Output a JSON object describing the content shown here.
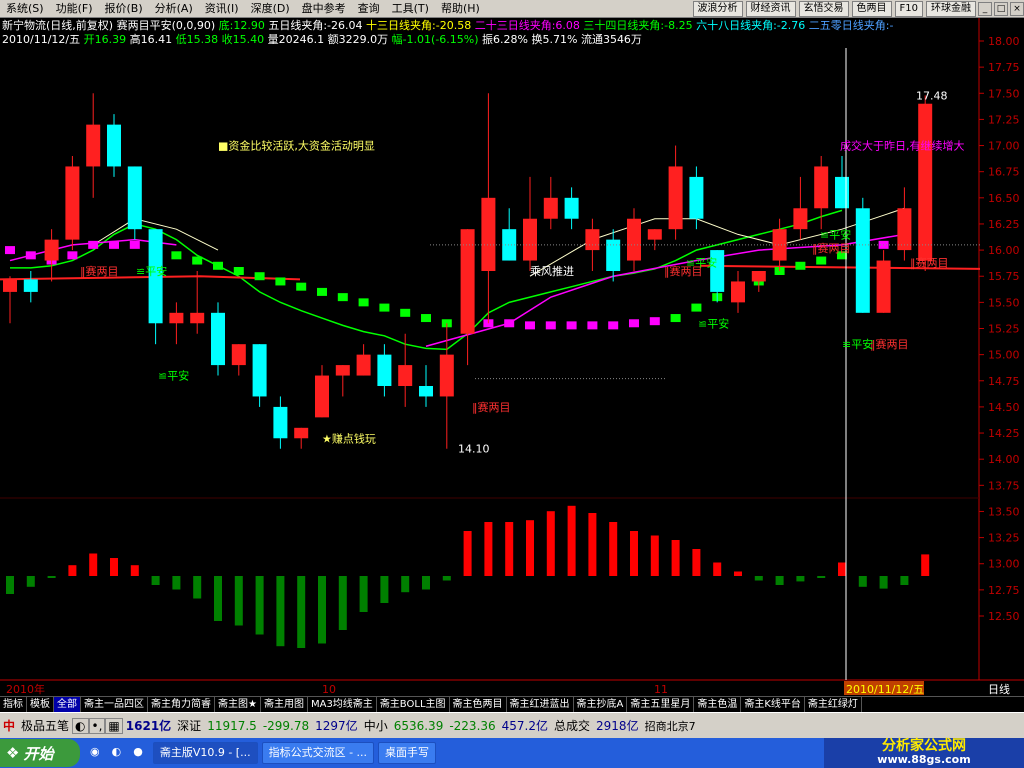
{
  "menu": {
    "items": [
      "系统(S)",
      "功能(F)",
      "报价(B)",
      "分析(A)",
      "资讯(I)",
      "深度(D)",
      "盘中参考",
      "查询",
      "工具(T)",
      "帮助(H)"
    ],
    "right_buttons": [
      "波浪分析",
      "财经资讯",
      "玄悟交易",
      "色两目",
      "F10",
      "环球金融"
    ]
  },
  "header": {
    "line1": "新宁物流(日线,前复权) 赛两目平安(0,0,90) 底:12.90  五日线夹角:-26.04 十三日线夹角:-20.58 二十三日线夹角:6.08 三十四日线夹角:-8.25 六十八日线夹角:-2.76 二五零日线夹角:-",
    "line1_parts": [
      {
        "text": "新宁物流(日线,前复权) 赛两目平安(0,0,90)",
        "color": "#ffffff"
      },
      {
        "text": " 底:12.90",
        "color": "#00ff00"
      },
      {
        "text": "  五日线夹角:-26.04",
        "color": "#ffffff"
      },
      {
        "text": " 十三日线夹角:-20.58",
        "color": "#ffff00"
      },
      {
        "text": " 二十三日线夹角:6.08",
        "color": "#ff00ff"
      },
      {
        "text": " 三十四日线夹角:-8.25",
        "color": "#00ff00"
      },
      {
        "text": " 六十八日线夹角:-2.76",
        "color": "#00ffff"
      },
      {
        "text": " 二五零日线夹角:-",
        "color": "#4d9fff"
      }
    ],
    "line2_parts": [
      {
        "text": "2010/11/12/五",
        "color": "#ffffff"
      },
      {
        "text": " 开16.39",
        "color": "#00ff00"
      },
      {
        "text": " 高16.41",
        "color": "#ffffff"
      },
      {
        "text": " 低15.38",
        "color": "#00ff00"
      },
      {
        "text": " 收15.40",
        "color": "#00ff00"
      },
      {
        "text": " 量20246.1 额3229.0万",
        "color": "#ffffff"
      },
      {
        "text": " 幅-1.01(-6.15%)",
        "color": "#00ff00"
      },
      {
        "text": " 振6.28% 换5.71% 流通3546万",
        "color": "#ffffff"
      }
    ]
  },
  "chart_data": {
    "type": "candlestick",
    "ylim": [
      12.3,
      18.05
    ],
    "y_ticks": [
      "18.00",
      "17.75",
      "17.50",
      "17.25",
      "17.00",
      "16.75",
      "16.50",
      "16.25",
      "16.00",
      "15.75",
      "15.50",
      "15.25",
      "15.00",
      "14.75",
      "14.50",
      "14.25",
      "14.00",
      "13.75",
      "13.50",
      "13.25",
      "13.00",
      "12.75",
      "12.50"
    ],
    "x_labels": [
      "2010年",
      "10",
      "11",
      "2010/11/12/五",
      "日线"
    ],
    "candles": [
      {
        "o": 15.6,
        "h": 15.75,
        "l": 15.3,
        "c": 15.72
      },
      {
        "o": 15.72,
        "h": 15.8,
        "l": 15.5,
        "c": 15.6
      },
      {
        "o": 15.9,
        "h": 16.2,
        "l": 15.7,
        "c": 16.1
      },
      {
        "o": 16.1,
        "h": 16.9,
        "l": 16.0,
        "c": 16.8
      },
      {
        "o": 16.8,
        "h": 17.5,
        "l": 16.5,
        "c": 17.2
      },
      {
        "o": 17.2,
        "h": 17.3,
        "l": 16.7,
        "c": 16.8
      },
      {
        "o": 16.8,
        "h": 16.8,
        "l": 16.1,
        "c": 16.2
      },
      {
        "o": 16.2,
        "h": 16.2,
        "l": 15.1,
        "c": 15.3
      },
      {
        "o": 15.3,
        "h": 15.5,
        "l": 15.1,
        "c": 15.4
      },
      {
        "o": 15.3,
        "h": 15.8,
        "l": 15.2,
        "c": 15.4
      },
      {
        "o": 15.4,
        "h": 15.5,
        "l": 14.8,
        "c": 14.9
      },
      {
        "o": 14.9,
        "h": 15.1,
        "l": 14.8,
        "c": 15.1
      },
      {
        "o": 15.1,
        "h": 15.1,
        "l": 14.5,
        "c": 14.6
      },
      {
        "o": 14.5,
        "h": 14.6,
        "l": 14.1,
        "c": 14.2
      },
      {
        "o": 14.2,
        "h": 14.3,
        "l": 14.1,
        "c": 14.3
      },
      {
        "o": 14.4,
        "h": 14.9,
        "l": 14.4,
        "c": 14.8
      },
      {
        "o": 14.8,
        "h": 14.9,
        "l": 14.6,
        "c": 14.9
      },
      {
        "o": 14.8,
        "h": 15.1,
        "l": 14.8,
        "c": 15.0
      },
      {
        "o": 15.0,
        "h": 15.1,
        "l": 14.6,
        "c": 14.7
      },
      {
        "o": 14.7,
        "h": 15.2,
        "l": 14.5,
        "c": 14.9
      },
      {
        "o": 14.7,
        "h": 14.9,
        "l": 14.5,
        "c": 14.6
      },
      {
        "o": 14.6,
        "h": 15.3,
        "l": 14.1,
        "c": 15.0
      },
      {
        "o": 15.2,
        "h": 16.2,
        "l": 14.9,
        "c": 16.2
      },
      {
        "o": 15.8,
        "h": 17.5,
        "l": 15.3,
        "c": 16.5
      },
      {
        "o": 16.2,
        "h": 16.4,
        "l": 15.9,
        "c": 15.9
      },
      {
        "o": 15.9,
        "h": 16.7,
        "l": 15.8,
        "c": 16.3
      },
      {
        "o": 16.3,
        "h": 16.7,
        "l": 16.2,
        "c": 16.5
      },
      {
        "o": 16.5,
        "h": 16.6,
        "l": 16.2,
        "c": 16.3
      },
      {
        "o": 16.0,
        "h": 16.3,
        "l": 15.8,
        "c": 16.2
      },
      {
        "o": 16.1,
        "h": 16.2,
        "l": 15.7,
        "c": 15.8
      },
      {
        "o": 15.9,
        "h": 16.4,
        "l": 15.8,
        "c": 16.3
      },
      {
        "o": 16.1,
        "h": 16.2,
        "l": 16.0,
        "c": 16.2
      },
      {
        "o": 16.2,
        "h": 17.0,
        "l": 16.1,
        "c": 16.8
      },
      {
        "o": 16.7,
        "h": 16.8,
        "l": 16.2,
        "c": 16.3
      },
      {
        "o": 16.0,
        "h": 16.0,
        "l": 15.5,
        "c": 15.6
      },
      {
        "o": 15.5,
        "h": 15.8,
        "l": 15.4,
        "c": 15.7
      },
      {
        "o": 15.7,
        "h": 15.8,
        "l": 15.6,
        "c": 15.8
      },
      {
        "o": 15.9,
        "h": 16.3,
        "l": 15.8,
        "c": 16.2
      },
      {
        "o": 16.2,
        "h": 16.7,
        "l": 16.1,
        "c": 16.4
      },
      {
        "o": 16.4,
        "h": 16.9,
        "l": 16.2,
        "c": 16.8
      },
      {
        "o": 16.7,
        "h": 16.9,
        "l": 16.4,
        "c": 16.4
      },
      {
        "o": 16.4,
        "h": 16.5,
        "l": 15.4,
        "c": 15.4
      },
      {
        "o": 15.4,
        "h": 16.0,
        "l": 15.4,
        "c": 15.9
      },
      {
        "o": 16.0,
        "h": 16.6,
        "l": 15.9,
        "c": 16.4
      },
      {
        "o": 15.9,
        "h": 17.48,
        "l": 15.8,
        "c": 17.4
      }
    ],
    "squares": [
      {
        "v": 16.0,
        "c": "#ff00ff"
      },
      {
        "v": 15.95,
        "c": "#ff00ff"
      },
      {
        "v": 15.9,
        "c": "#ff00ff"
      },
      {
        "v": 15.95,
        "c": "#ff00ff"
      },
      {
        "v": 16.05,
        "c": "#ff00ff"
      },
      {
        "v": 16.05,
        "c": "#ff00ff"
      },
      {
        "v": 16.05,
        "c": "#ff00ff"
      },
      {
        "v": 16.0,
        "c": "#ff00ff"
      },
      {
        "v": 15.95,
        "c": "#00ff00"
      },
      {
        "v": 15.9,
        "c": "#00ff00"
      },
      {
        "v": 15.85,
        "c": "#00ff00"
      },
      {
        "v": 15.8,
        "c": "#00ff00"
      },
      {
        "v": 15.75,
        "c": "#00ff00"
      },
      {
        "v": 15.7,
        "c": "#00ff00"
      },
      {
        "v": 15.65,
        "c": "#00ff00"
      },
      {
        "v": 15.6,
        "c": "#00ff00"
      },
      {
        "v": 15.55,
        "c": "#00ff00"
      },
      {
        "v": 15.5,
        "c": "#00ff00"
      },
      {
        "v": 15.45,
        "c": "#00ff00"
      },
      {
        "v": 15.4,
        "c": "#00ff00"
      },
      {
        "v": 15.35,
        "c": "#00ff00"
      },
      {
        "v": 15.3,
        "c": "#00ff00"
      },
      {
        "v": 15.3,
        "c": "#ff00ff"
      },
      {
        "v": 15.3,
        "c": "#ff00ff"
      },
      {
        "v": 15.3,
        "c": "#ff00ff"
      },
      {
        "v": 15.28,
        "c": "#ff00ff"
      },
      {
        "v": 15.28,
        "c": "#ff00ff"
      },
      {
        "v": 15.28,
        "c": "#ff00ff"
      },
      {
        "v": 15.28,
        "c": "#ff00ff"
      },
      {
        "v": 15.28,
        "c": "#ff00ff"
      },
      {
        "v": 15.3,
        "c": "#ff00ff"
      },
      {
        "v": 15.32,
        "c": "#ff00ff"
      },
      {
        "v": 15.35,
        "c": "#00ff00"
      },
      {
        "v": 15.45,
        "c": "#00ff00"
      },
      {
        "v": 15.55,
        "c": "#00ff00"
      },
      {
        "v": 15.6,
        "c": "#00ff00"
      },
      {
        "v": 15.7,
        "c": "#00ff00"
      },
      {
        "v": 15.8,
        "c": "#00ff00"
      },
      {
        "v": 15.85,
        "c": "#00ff00"
      },
      {
        "v": 15.9,
        "c": "#00ff00"
      },
      {
        "v": 15.95,
        "c": "#00ff00"
      },
      {
        "v": 16.0,
        "c": "#ff00ff"
      },
      {
        "v": 16.05,
        "c": "#ff00ff"
      },
      {
        "v": 16.1,
        "c": "#ff00ff"
      },
      {
        "v": 16.15,
        "c": "#ff00ff"
      }
    ],
    "macd": [
      -0.2,
      -0.12,
      -0.02,
      0.12,
      0.25,
      0.2,
      0.12,
      -0.1,
      -0.15,
      -0.25,
      -0.5,
      -0.55,
      -0.65,
      -0.78,
      -0.8,
      -0.75,
      -0.6,
      -0.4,
      -0.3,
      -0.18,
      -0.15,
      -0.05,
      0.5,
      0.6,
      0.6,
      0.62,
      0.72,
      0.78,
      0.7,
      0.6,
      0.5,
      0.45,
      0.4,
      0.3,
      0.15,
      0.05,
      -0.05,
      -0.1,
      -0.06,
      -0.02,
      0.15,
      -0.12,
      -0.14,
      -0.1,
      0.24
    ],
    "ma_green": [
      15.83,
      15.83,
      15.85,
      15.9,
      16.0,
      16.15,
      16.25,
      16.2,
      16.1,
      15.95,
      15.85,
      15.75,
      15.6,
      15.5,
      15.42,
      15.35,
      15.28,
      15.22,
      15.18,
      15.1,
      15.06,
      15.05,
      15.2,
      15.4,
      15.5,
      15.55,
      15.6,
      15.65,
      15.7,
      15.75,
      15.78,
      15.82,
      15.9,
      16.0,
      16.05,
      16.1,
      16.15,
      16.2,
      16.25,
      16.32,
      16.38
    ],
    "annotations": {
      "big_money": "■资金比较活跃,大资金活动明显",
      "earn": "★赚点钱玩",
      "ride_wind": "乘风推进",
      "volume_note": "成交大于昨日,有继续增大",
      "sai": "赛两目",
      "pingan": "平安",
      "high_label": "17.48",
      "low_label": "14.10"
    }
  },
  "tabs": [
    "指标",
    "模板",
    "全部",
    "斋主一品四区",
    "斋主角力简睿",
    "斋主图★",
    "斋主用图",
    "MA3均线斋主",
    "斋主BOLL主图",
    "斋主色两目",
    "斋主红进蓝出",
    "斋主抄底A",
    "斋主五里星月",
    "斋主色温",
    "斋主K线平台",
    "斋主红绿灯"
  ],
  "status": {
    "brand": "极品五笔",
    "amount1": "1621亿",
    "sz_label": "深证",
    "sz_index": "11917.5",
    "sz_change": "-299.78",
    "sz_amount": "1297亿",
    "zx_label": "中小",
    "zx_index": "6536.39",
    "zx_change": "-223.36",
    "zx_amount": "457.2亿",
    "total_label": "总成交",
    "total": "2918亿",
    "broker": "招商北京7"
  },
  "taskbar": {
    "start": "开始",
    "tasks": [
      "斋主版V10.9 - [...",
      "指标公式交流区 - ...",
      "桌面手写"
    ],
    "logo_title": "分析家公式网",
    "logo_url": "www.88gs.com"
  }
}
